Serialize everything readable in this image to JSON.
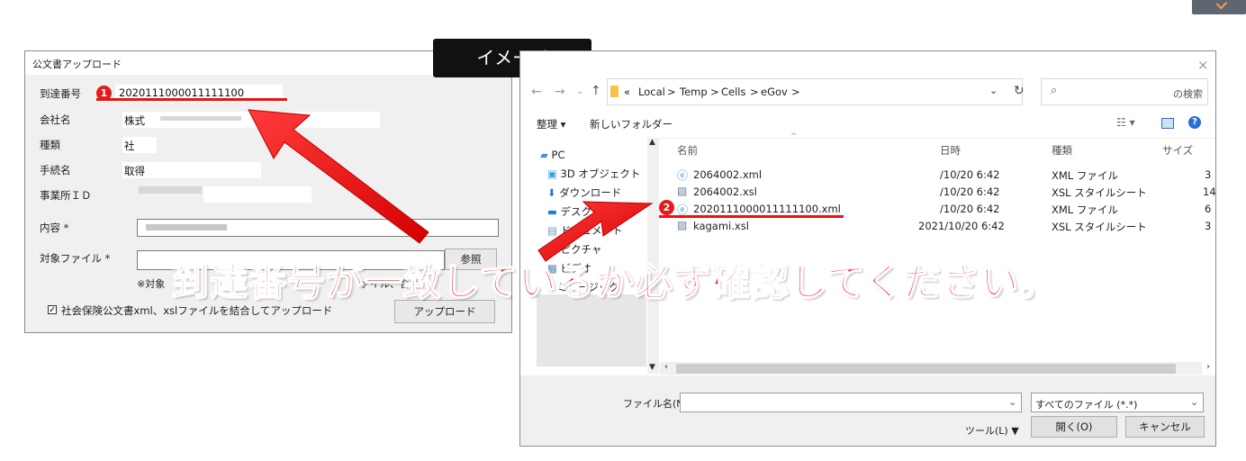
{
  "image_label": "イメージ",
  "upload_dialog": {
    "title": "公文書アップロード",
    "fields": {
      "arrival_label": "到達番号",
      "arrival_value": "2020111000011111100",
      "company_label": "会社名",
      "company_value": "株式",
      "type_label": "種類",
      "type_value": "社",
      "procedure_label": "手続名",
      "procedure_value": "取得",
      "office_label": "事業所ＩＤ",
      "content_label": "内容 *",
      "file_label": "対象ファイル *"
    },
    "browse_button": "参照",
    "note": "※対象",
    "note_tail": "ァイル、合計",
    "checkbox_label": "社会保険公文書xml、xslファイルを結合してアップロード",
    "upload_button": "アップロード"
  },
  "file_dialog": {
    "close": "×",
    "breadcrumb": [
      "«",
      "Local",
      ">",
      "Temp",
      ">",
      "Cells",
      ">",
      "eGov",
      ">"
    ],
    "search_placeholder": "の検索",
    "toolbar": {
      "organize": "整理 ▾",
      "new_folder": "新しいフォルダー"
    },
    "nav_items": [
      "PC",
      "3D オブジェクト",
      "ダウンロード",
      "デスクトップ",
      "ドキュメント",
      "ピクチャ",
      "ビデオ",
      "ミュージック"
    ],
    "columns": {
      "name": "名前",
      "date": "日時",
      "type": "種類",
      "size": "サイズ"
    },
    "files": [
      {
        "name": "2064002.xml",
        "date": "/10/20 6:42",
        "type": "XML ファイル",
        "size": "3"
      },
      {
        "name": "2064002.xsl",
        "date": "/10/20 6:42",
        "type": "XSL スタイルシート",
        "size": "14"
      },
      {
        "name": "2020111000011111100.xml",
        "date": "/10/20 6:42",
        "type": "XML ファイル",
        "size": "6"
      },
      {
        "name": "kagami.xsl",
        "date": "2021/10/20 6:42",
        "type": "XSL スタイルシート",
        "size": "3"
      }
    ],
    "filename_label": "ファイル名(N):",
    "filetype_value": "すべてのファイル (*.*)",
    "tools": "ツール(L)",
    "open_button": "開く(O)",
    "cancel_button": "キャンセル"
  },
  "badges": [
    "1",
    "2"
  ],
  "caption": "到達番号が一致しているか必ず確認してください。",
  "colors": {
    "accent_red": "#e11b1b",
    "caption_red": "#ff2020",
    "label_bg": "#111111"
  }
}
